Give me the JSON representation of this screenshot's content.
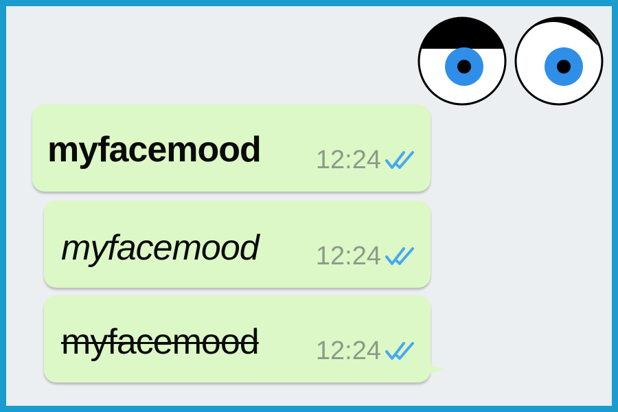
{
  "messages": [
    {
      "text": "myfacemood",
      "style": "bold",
      "time": "12:24",
      "status_icon": "double-check-icon"
    },
    {
      "text": "myfacemood",
      "style": "italic",
      "time": "12:24",
      "status_icon": "double-check-icon"
    },
    {
      "text": "myfacemood",
      "style": "strikethrough",
      "time": "12:24",
      "status_icon": "double-check-icon"
    }
  ],
  "decoration": {
    "icon": "eyes-icon"
  },
  "colors": {
    "frame_border": "#1b9ccf",
    "chat_background": "#eceff1",
    "bubble": "#dcf8c6",
    "time_text": "#8c9a8a",
    "read_ticks": "#4aa8ee",
    "iris": "#2f8fe8"
  }
}
